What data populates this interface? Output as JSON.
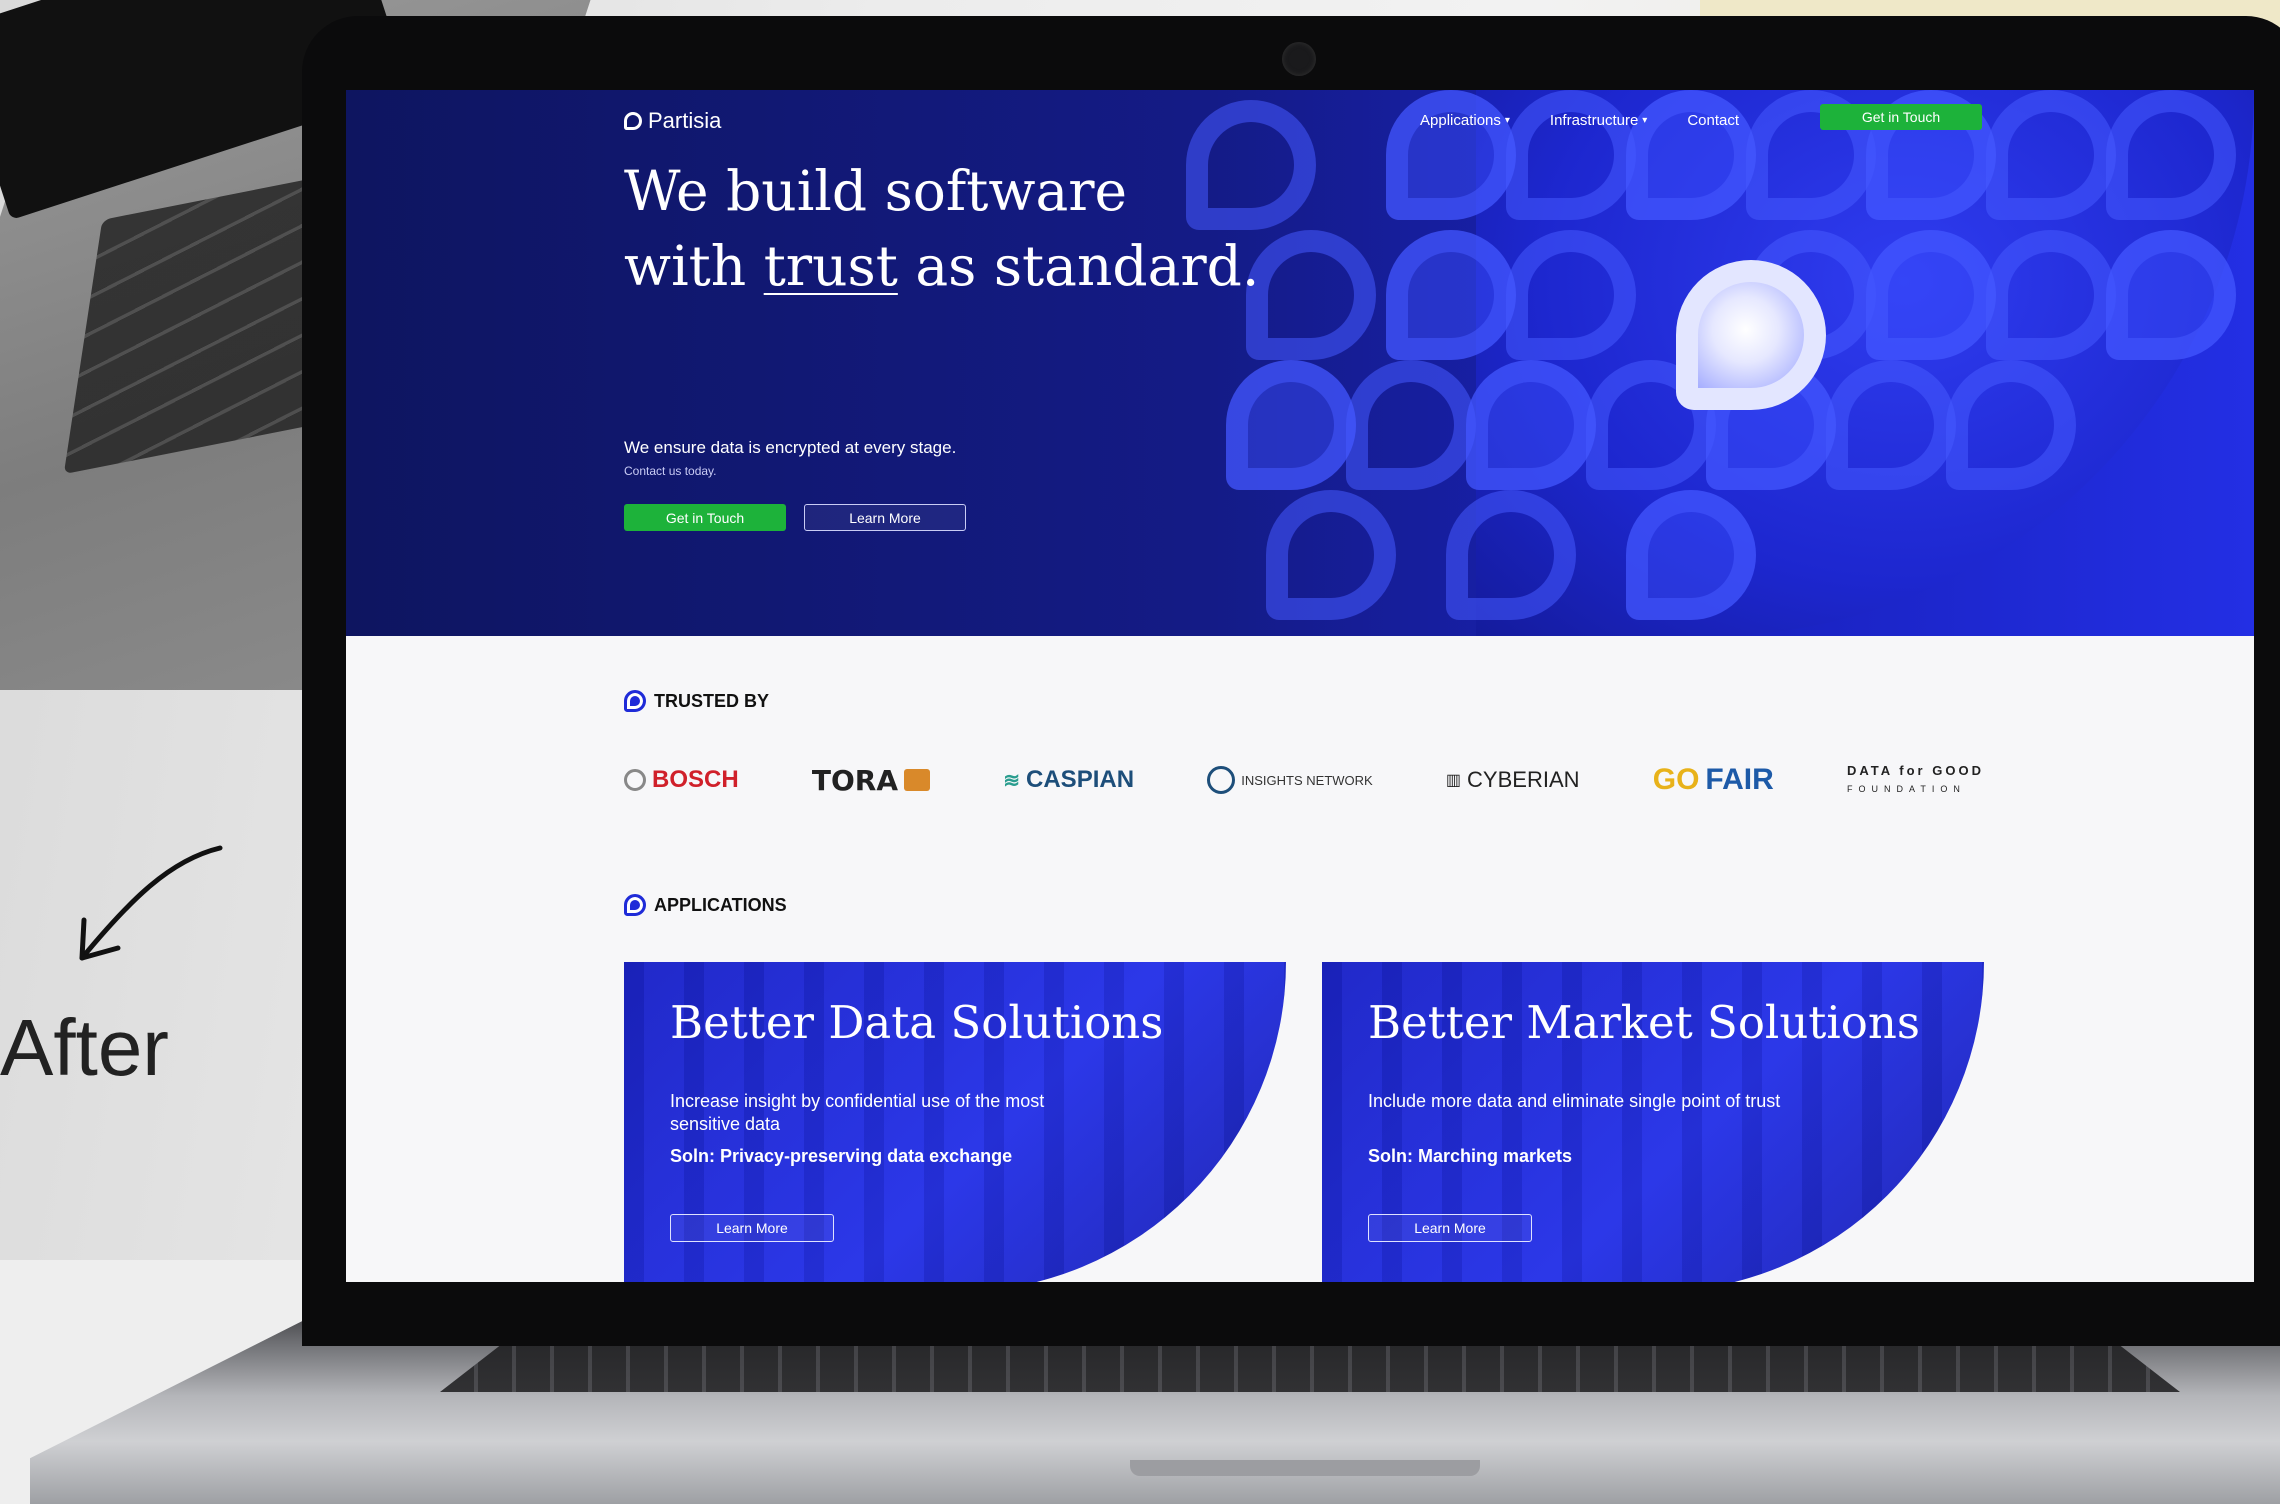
{
  "caption": {
    "after_label": "After"
  },
  "site": {
    "logo_text": "Partisia",
    "nav": {
      "items": [
        {
          "label": "Applications",
          "has_dropdown": true
        },
        {
          "label": "Infrastructure",
          "has_dropdown": true
        },
        {
          "label": "Contact",
          "has_dropdown": false
        }
      ],
      "cta_label": "Get in Touch"
    },
    "hero": {
      "title_line1": "We build software",
      "title_line2_pre": "with ",
      "title_line2_underlined": "trust",
      "title_line2_post": " as standard.",
      "subtitle": "We ensure data is encrypted at every stage.",
      "subtext": "Contact us today.",
      "primary_button": "Get in Touch",
      "secondary_button": "Learn More"
    },
    "trusted": {
      "heading": "TRUSTED BY",
      "logos": {
        "bosch": "BOSCH",
        "tora": "TORA",
        "caspian": "CASPIAN",
        "insights": "INSIGHTS NETWORK",
        "cyberian": "CYBERIAN",
        "gofair_go": "GO",
        "gofair_fair": "FAIR",
        "dataforgood_top": "DATA for GOOD",
        "dataforgood_bottom": "FOUNDATION"
      }
    },
    "applications": {
      "heading": "APPLICATIONS",
      "cards": [
        {
          "title": "Better Data Solutions",
          "description": "Increase insight by confidential use of the most sensitive data",
          "solution": "Soln: Privacy-preserving data exchange",
          "button": "Learn More"
        },
        {
          "title": "Better Market Solutions",
          "description": "Include more data and eliminate single point of trust",
          "solution": "Soln: Marching markets",
          "button": "Learn More"
        }
      ]
    }
  },
  "colors": {
    "hero_dark": "#0e1560",
    "hero_bright": "#232fe4",
    "cta_green": "#1db23a",
    "page_bg": "#f7f7f9",
    "bosch_red": "#d0202a"
  },
  "icons": [
    "curved-arrow-icon",
    "partisia-logo-icon",
    "section-drop-icon",
    "chevron-down-icon"
  ]
}
